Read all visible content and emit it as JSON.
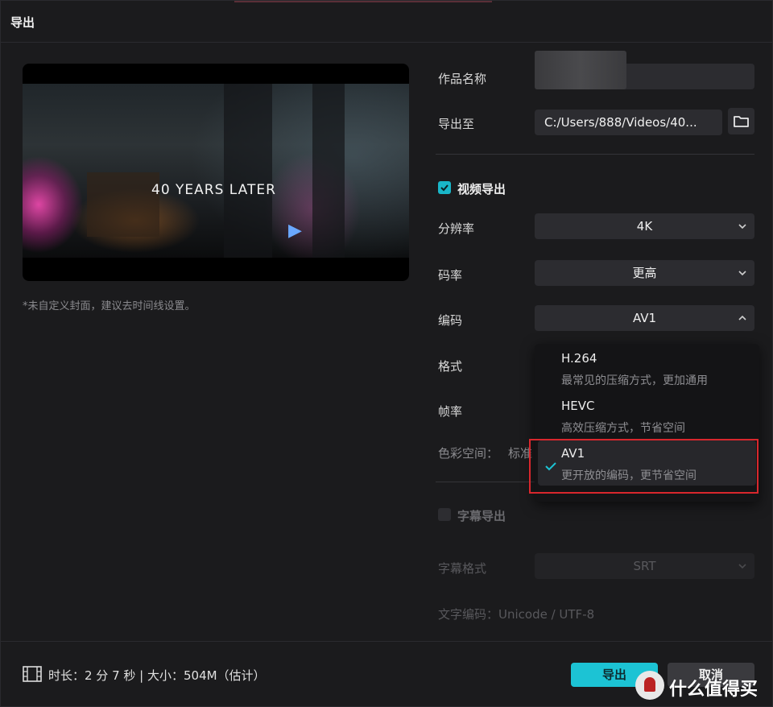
{
  "window": {
    "title": "导出"
  },
  "preview": {
    "overlay_text": "40 YEARS LATER",
    "cover_note": "*未自定义封面，建议去时间线设置。"
  },
  "form": {
    "name_label": "作品名称",
    "name_value": "",
    "export_to_label": "导出至",
    "export_path": "C:/Users/888/Videos/40...",
    "video_section": {
      "label": "视频导出",
      "checked": true
    },
    "resolution": {
      "label": "分辨率",
      "value": "4K"
    },
    "bitrate": {
      "label": "码率",
      "value": "更高"
    },
    "codec": {
      "label": "编码",
      "value": "AV1",
      "expanded": true
    },
    "format": {
      "label": "格式"
    },
    "framerate": {
      "label": "帧率"
    },
    "color_space": {
      "label": "色彩空间：",
      "value": "标准"
    },
    "subtitle_section": {
      "label": "字幕导出",
      "checked": false
    },
    "subtitle_format": {
      "label": "字幕格式",
      "value": "SRT"
    },
    "text_encoding": "文字编码：Unicode / UTF-8"
  },
  "codec_menu": [
    {
      "name": "H.264",
      "desc": "最常见的压缩方式，更加通用",
      "selected": false
    },
    {
      "name": "HEVC",
      "desc": "高效压缩方式，节省空间",
      "selected": false
    },
    {
      "name": "AV1",
      "desc": "更开放的编码，更节省空间",
      "selected": true
    }
  ],
  "footer": {
    "meta": "时长：2 分 7 秒 | 大小：504M（估计）",
    "export_label": "导出",
    "cancel_label": "取消"
  },
  "watermark": {
    "text": "什么值得买"
  },
  "colors": {
    "accent": "#1cc3d4",
    "highlight_box": "#d8272d",
    "background": "#1b1b1d"
  },
  "icons": [
    "folder-icon",
    "checkbox-icon",
    "chevron-down-icon",
    "chevron-up-icon",
    "check-icon",
    "film-icon"
  ]
}
